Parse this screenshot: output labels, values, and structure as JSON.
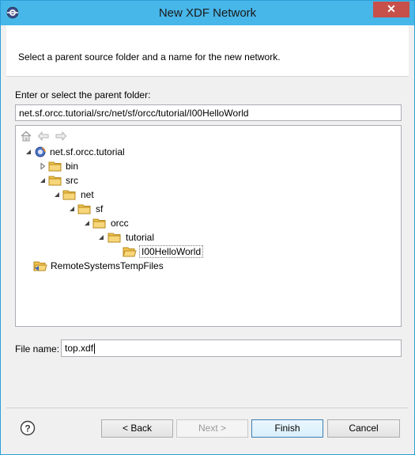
{
  "window": {
    "title": "New XDF Network"
  },
  "banner": {
    "message": "Select a parent source folder and a name for the new network."
  },
  "folder": {
    "label": "Enter or select the parent folder:",
    "path": "net.sf.orcc.tutorial/src/net/sf/orcc/tutorial/I00HelloWorld"
  },
  "tree": {
    "items": [
      {
        "label": "net.sf.orcc.tutorial",
        "icon": "project-icon",
        "state": "expanded"
      },
      {
        "label": "bin",
        "icon": "folder-icon",
        "state": "collapsed"
      },
      {
        "label": "src",
        "icon": "folder-icon",
        "state": "expanded"
      },
      {
        "label": "net",
        "icon": "folder-icon",
        "state": "expanded"
      },
      {
        "label": "sf",
        "icon": "folder-icon",
        "state": "expanded"
      },
      {
        "label": "orcc",
        "icon": "folder-icon",
        "state": "expanded"
      },
      {
        "label": "tutorial",
        "icon": "folder-icon",
        "state": "expanded"
      },
      {
        "label": "I00HelloWorld",
        "icon": "folder-open-icon",
        "state": "selected"
      },
      {
        "label": "RemoteSystemsTempFiles",
        "icon": "remote-folder-icon",
        "state": "leaf"
      }
    ]
  },
  "file": {
    "label": "File name:",
    "value": "top.xdf"
  },
  "buttons": {
    "back": "< Back",
    "next": "Next >",
    "finish": "Finish",
    "cancel": "Cancel"
  },
  "colors": {
    "titlebar": "#47b6e9",
    "close": "#c7504a",
    "folder": "#e8b84a"
  }
}
